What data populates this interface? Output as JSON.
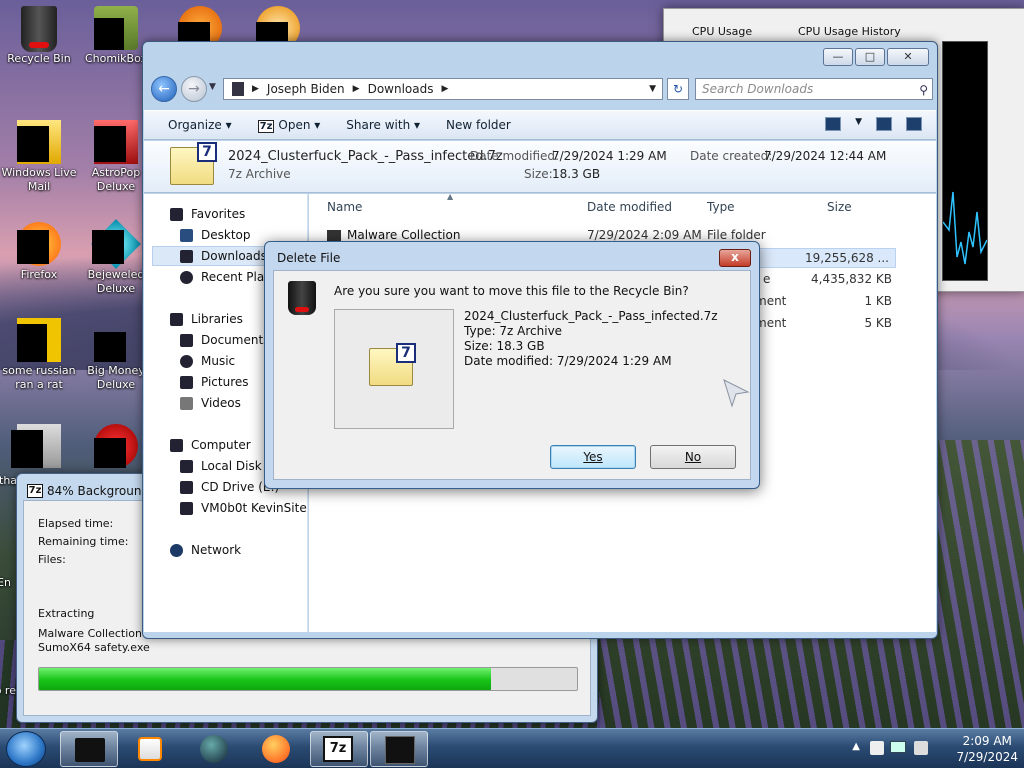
{
  "desktop": {
    "icons": [
      {
        "label": "Recycle Bin"
      },
      {
        "label": "ChomikBox"
      },
      {
        "label": "Windows Live Mail"
      },
      {
        "label": "AstroPop Deluxe"
      },
      {
        "label": "Firefox"
      },
      {
        "label": "Bejeweled Deluxe"
      },
      {
        "label": "some russian ran a rat"
      },
      {
        "label": "Big Money Deluxe"
      },
      {
        "label": "tha"
      },
      {
        "label": "En"
      },
      {
        "label": "no ret"
      }
    ]
  },
  "taskmgr": {
    "tab1": "CPU Usage",
    "tab2": "CPU Usage History"
  },
  "explorer": {
    "breadcrumb": [
      "Joseph Biden",
      "Downloads"
    ],
    "search_placeholder": "Search Downloads",
    "toolbar": {
      "organize": "Organize",
      "open": "Open",
      "share": "Share with",
      "new_folder": "New folder"
    },
    "details": {
      "filename": "2024_Clusterfuck_Pack_-_Pass_infected.7z",
      "type": "7z Archive",
      "date_modified_label": "Date modified:",
      "date_modified": "7/29/2024 1:29 AM",
      "date_created_label": "Date created:",
      "date_created": "7/29/2024 12:44 AM",
      "size_label": "Size:",
      "size": "18.3 GB"
    },
    "nav": {
      "favorites": "Favorites",
      "desktop": "Desktop",
      "downloads": "Downloads",
      "recent": "Recent Place",
      "libraries": "Libraries",
      "documents": "Documents",
      "music": "Music",
      "pictures": "Pictures",
      "videos": "Videos",
      "computer": "Computer",
      "local_disk": "Local Disk (C",
      "cd_drive": "CD Drive (E:)",
      "share": "VM0b0t KevinSite",
      "network": "Network"
    },
    "columns": {
      "name": "Name",
      "date": "Date modified",
      "type": "Type",
      "size": "Size"
    },
    "rows": [
      {
        "name": "Malware Collection",
        "date": "7/29/2024 2:09 AM",
        "type": "File folder",
        "size": ""
      },
      {
        "name": "",
        "date": "",
        "type": "",
        "size": "19,255,628 ..."
      },
      {
        "name": "",
        "date": "",
        "type": "e",
        "size": "4,435,832 KB"
      },
      {
        "name": "",
        "date": "",
        "type": "ment",
        "size": "1 KB"
      },
      {
        "name": "",
        "date": "",
        "type": "ment",
        "size": "5 KB"
      }
    ]
  },
  "dialog": {
    "title": "Delete File",
    "question": "Are you sure you want to move this file to the Recycle Bin?",
    "file_name": "2024_Clusterfuck_Pack_-_Pass_infected.7z",
    "file_type": "Type: 7z Archive",
    "file_size": "Size: 18.3 GB",
    "file_date": "Date modified: 7/29/2024 1:29 AM",
    "yes": "Yes",
    "no": "No",
    "close_glyph": "x"
  },
  "progress": {
    "title": "84% Background",
    "elapsed_label": "Elapsed time:",
    "remaining_label": "Remaining time:",
    "files_label": "Files:",
    "extracting_label": "Extracting",
    "path_line1": "Malware Collection\\",
    "path_line2": "SumoX64 safety.exe",
    "percent": 84
  },
  "taskbar": {
    "time": "2:09 AM",
    "date": "7/29/2024"
  },
  "icons_7z": "7"
}
